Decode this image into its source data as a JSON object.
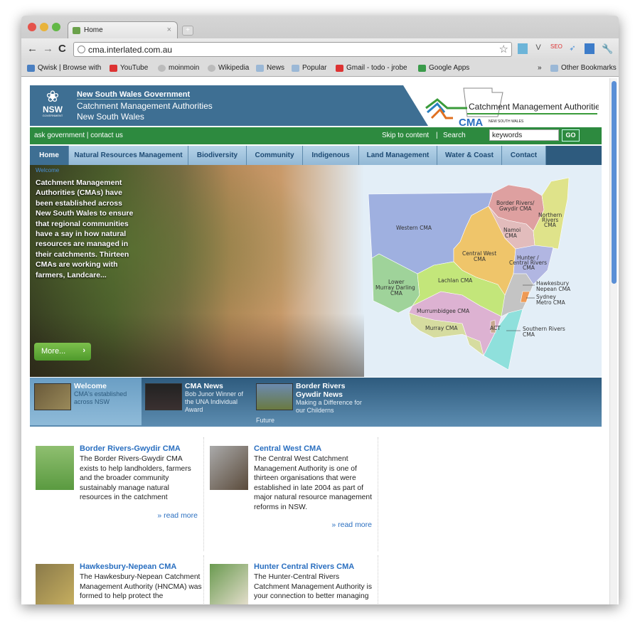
{
  "browser": {
    "tab_title": "Home",
    "url": "cma.interlated.com.au",
    "bookmarks": [
      "Qwisk | Browse with",
      "YouTube",
      "moinmoin",
      "Wikipedia",
      "News",
      "Popular",
      "Gmail - todo - jrobe",
      "Google Apps"
    ],
    "overflow": "»",
    "other_bookmarks": "Other Bookmarks"
  },
  "header": {
    "gov": "New South Wales Government",
    "line2": "Catchment Management Authorities",
    "line3": "New South Wales",
    "nsw_logo": "NSW",
    "nsw_logo_sub": "GOVERNMENT",
    "cma_logo": {
      "title": "Catchment Management Authorities",
      "abbr": "CMA",
      "sub": "NEW SOUTH WALES"
    }
  },
  "utility": {
    "left": "ask government | contact us",
    "skip": "Skip to content",
    "sep": "|",
    "search_label": "Search",
    "search_value": "keywords",
    "go": "GO"
  },
  "nav": [
    {
      "label": "Home",
      "active": true
    },
    {
      "label": "Natural Resources Management"
    },
    {
      "label": "Biodiversity"
    },
    {
      "label": "Community"
    },
    {
      "label": "Indigenous"
    },
    {
      "label": "Land Management"
    },
    {
      "label": "Water & Coast"
    },
    {
      "label": "Contact"
    }
  ],
  "hero": {
    "label": "Welcome",
    "text": "Catchment Management Authorities (CMAs) have been established across New South Wales to ensure that regional communities have a say in how natural resources are managed in their catchments. Thirteen CMAs are working with farmers, Landcare...",
    "more": "More...",
    "map_labels": {
      "western": "Western CMA",
      "border": [
        "Border Rivers/",
        "Gwydir CMA"
      ],
      "northern": [
        "Northern",
        "Rivers",
        "CMA"
      ],
      "namoi": [
        "Namoi",
        "CMA"
      ],
      "central_west": [
        "Central West",
        "CMA"
      ],
      "hunter": [
        "Hunter /",
        "Central Rivers",
        "CMA"
      ],
      "lachlan": "Lachlan CMA",
      "lower_murray": [
        "Lower",
        "Murray Darling",
        "CMA"
      ],
      "hawkesbury": [
        "Hawkesbury",
        "Nepean CMA"
      ],
      "sydney": [
        "Sydney",
        "Metro CMA"
      ],
      "murrumbidgee": "Murrumbidgee CMA",
      "murray": "Murray CMA",
      "act": "ACT",
      "southern": [
        "Southern Rivers",
        "CMA"
      ]
    }
  },
  "news_strip": [
    {
      "title": "Welcome",
      "text": "CMA's established across NSW"
    },
    {
      "title": "CMA News",
      "text": "Bob Junor Winner of the UNA Individual Award"
    },
    {
      "title": "Border Rivers Gywdir News",
      "text": "Making a Difference for our Childerns",
      "extra": "Future"
    }
  ],
  "cards": [
    {
      "title": "Border Rivers-Gwydir CMA",
      "body": "The Border Rivers-Gwydir CMA exists to help landholders, farmers and the broader community sustainably manage natural resources in the catchment",
      "more": "» read more"
    },
    {
      "title": "Central West CMA",
      "body": "The Central West Catchment Management Authority is one of thirteen organisations that were established in late 2004 as part of major natural resource management reforms in NSW.",
      "more": "» read more"
    },
    {
      "title": "Hawkesbury-Nepean CMA",
      "body": "The Hawkesbury-Nepean Catchment Management Authority (HNCMA) was formed to help protect the"
    },
    {
      "title": "Hunter Central Rivers CMA",
      "body": "The Hunter-Central Rivers Catchment Management Authority is your connection to better managing"
    }
  ],
  "colors": {
    "header_blue": "#3e6f93",
    "green_bar": "#2d8a3f",
    "link": "#2a6fc0"
  }
}
